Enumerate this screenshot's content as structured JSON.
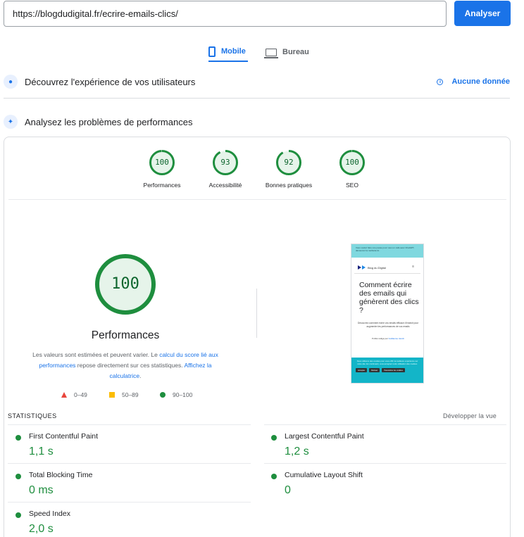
{
  "search": {
    "url": "https://blogdudigital.fr/ecrire-emails-clics/",
    "button": "Analyser"
  },
  "tabs": [
    {
      "label": "Mobile",
      "icon": "phone-icon",
      "active": true
    },
    {
      "label": "Bureau",
      "icon": "desktop-icon",
      "active": false
    }
  ],
  "sections": {
    "experience": {
      "title": "Découvrez l'expérience de vos utilisateurs",
      "link": "Aucune donnée"
    },
    "performance": {
      "title": "Analysez les problèmes de performances"
    }
  },
  "scores": [
    {
      "label": "Performances",
      "value": "100"
    },
    {
      "label": "Accessibilité",
      "value": "93"
    },
    {
      "label": "Bonnes pratiques",
      "value": "92"
    },
    {
      "label": "SEO",
      "value": "100"
    }
  ],
  "main_gauge": {
    "value": "100",
    "title": "Performances"
  },
  "description": {
    "p1": "Les valeurs sont estimées et peuvent varier. Le ",
    "link1": "calcul du score lié aux performances",
    "p2": " repose directement sur ces statistiques. ",
    "link2": "Affichez la calculatrice",
    "p3": "."
  },
  "legend": [
    {
      "range": "0–49",
      "color": "#e8453c"
    },
    {
      "range": "50–89",
      "color": "#fbbc04"
    },
    {
      "range": "90–100",
      "color": "#1e8e3e"
    }
  ],
  "preview": {
    "banner": "Vous voulez faire une pause pour vous un café avec ChatGPT, découvrez la méthode IA.",
    "logo": "Blog du Digital",
    "heading": "Comment écrire des emails qui génèrent des clics ?",
    "sub": "Découvrez comment écrire vos emails efficace d'endroit pour augmenter les performances de vos emails",
    "author_prefix": "Publié rédigé par",
    "author": "Guillaume Jacob",
    "cookie": "Nous utilisons des cookies pour vous offrir la meilleure expérience sur notre site. En continuant, vous acceptez notre utilisation des cookies.",
    "btn1": "Accepter",
    "btn2": "Refuser",
    "btn3": "Paramétrer les cookies"
  },
  "stats": {
    "label": "STATISTIQUES",
    "expand": "Développer la vue",
    "metrics": [
      {
        "name": "First Contentful Paint",
        "value": "1,1 s"
      },
      {
        "name": "Largest Contentful Paint",
        "value": "1,2 s"
      },
      {
        "name": "Total Blocking Time",
        "value": "0 ms"
      },
      {
        "name": "Cumulative Layout Shift",
        "value": "0"
      },
      {
        "name": "Speed Index",
        "value": "2,0 s"
      }
    ]
  },
  "colors": {
    "accent": "#1a73e8",
    "pass": "#1e8e3e",
    "pass_text": "#0d652d",
    "pass_fill": "#e6f4ea"
  }
}
